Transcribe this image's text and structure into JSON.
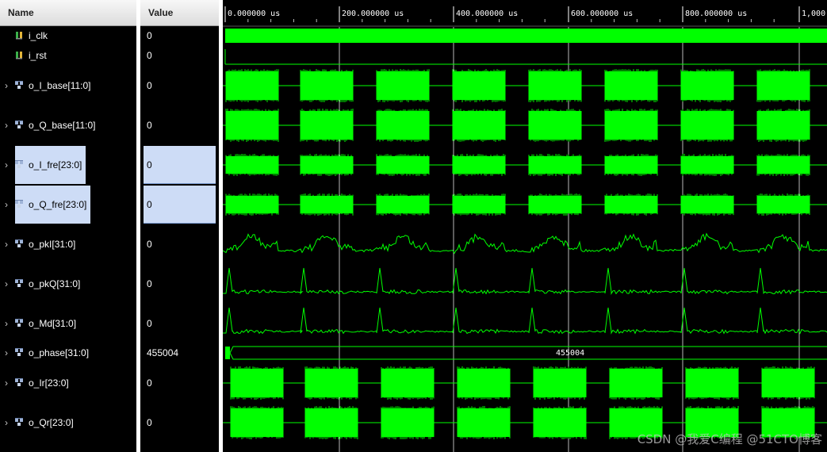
{
  "columns": {
    "name": "Name",
    "value": "Value"
  },
  "timeline": {
    "unit": "us",
    "ticks": [
      "0.000000 us",
      "200.000000 us",
      "400.000000 us",
      "600.000000 us",
      "800.000000 us",
      "1,000."
    ]
  },
  "signals": [
    {
      "name": "i_clk",
      "value": "0",
      "type": "clock",
      "icon": "bit-signal-icon"
    },
    {
      "name": "i_rst",
      "value": "0",
      "type": "reset",
      "icon": "bit-signal-icon"
    },
    {
      "name": "o_I_base[11:0]",
      "value": "0",
      "type": "burst",
      "icon": "bus-signal-icon"
    },
    {
      "name": "o_Q_base[11:0]",
      "value": "0",
      "type": "burst",
      "icon": "bus-signal-icon"
    },
    {
      "name": "o_I_fre[23:0]",
      "value": "0",
      "type": "burst",
      "icon": "bus-signal-icon",
      "selected": true
    },
    {
      "name": "o_Q_fre[23:0]",
      "value": "0",
      "type": "burst",
      "icon": "bus-signal-icon",
      "selected": true
    },
    {
      "name": "o_pkI[31:0]",
      "value": "0",
      "type": "analog-hump",
      "icon": "bus-signal-icon"
    },
    {
      "name": "o_pkQ[31:0]",
      "value": "0",
      "type": "analog-spike",
      "icon": "bus-signal-icon"
    },
    {
      "name": "o_Md[31:0]",
      "value": "0",
      "type": "analog-spike",
      "icon": "bus-signal-icon"
    },
    {
      "name": "o_phase[31:0]",
      "value": "455004",
      "type": "bus-value",
      "icon": "bus-signal-icon",
      "bus_label": "455004"
    },
    {
      "name": "o_Ir[23:0]",
      "value": "0",
      "type": "burst",
      "icon": "bus-signal-icon"
    },
    {
      "name": "o_Qr[23:0]",
      "value": "0",
      "type": "burst",
      "icon": "bus-signal-icon"
    }
  ],
  "watermark": "CSDN @我爱C编程 @51CTO博客",
  "colors": {
    "wave": "#00ff00",
    "cursor": "#d8d8d8",
    "selection": "#cddcf6"
  }
}
